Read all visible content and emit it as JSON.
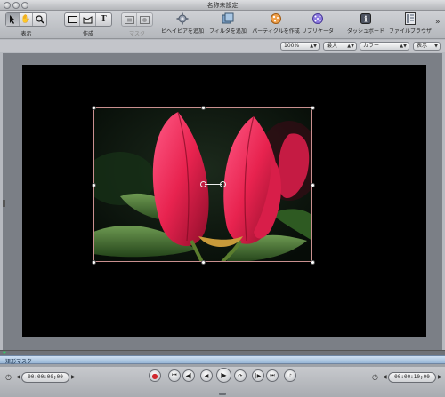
{
  "window": {
    "title": "名称未設定"
  },
  "toolbar": {
    "view_label": "表示",
    "create_label": "作成",
    "mask_label": "マスク",
    "add_behavior": "ビヘイビアを追加",
    "add_filter": "フィルタを追加",
    "make_particles": "パーティクルを作成",
    "replicate": "リプリケータ",
    "dashboard": "ダッシュボード",
    "file_browser": "ファイルブラウザ",
    "more": "»",
    "view_tools": [
      "select-arrow-icon",
      "hand-icon",
      "zoom-icon"
    ],
    "create_tools": [
      "rectangle-icon",
      "bezier-icon",
      "text-icon"
    ],
    "mask_tools": [
      "rect-mask-icon",
      "circle-mask-icon"
    ]
  },
  "options": {
    "zoom": "100%",
    "quality": "最大",
    "channels": "カラー",
    "view": "表示"
  },
  "timeline": {
    "track_label": "矩形マスク"
  },
  "transport": {
    "timecode_start": "00:00:00;00",
    "timecode_end": "00:00:10;00",
    "buttons": [
      "record-icon",
      "go-to-start-icon",
      "step-back-icon",
      "play-reverse-icon",
      "play-icon",
      "loop-icon",
      "step-forward-icon",
      "go-to-end-icon",
      "audio-icon"
    ]
  },
  "colors": {
    "accent": "#6f86a3",
    "flower": "#e8234f",
    "leaf": "#3d6a2a",
    "selection": "#c98f8f"
  }
}
